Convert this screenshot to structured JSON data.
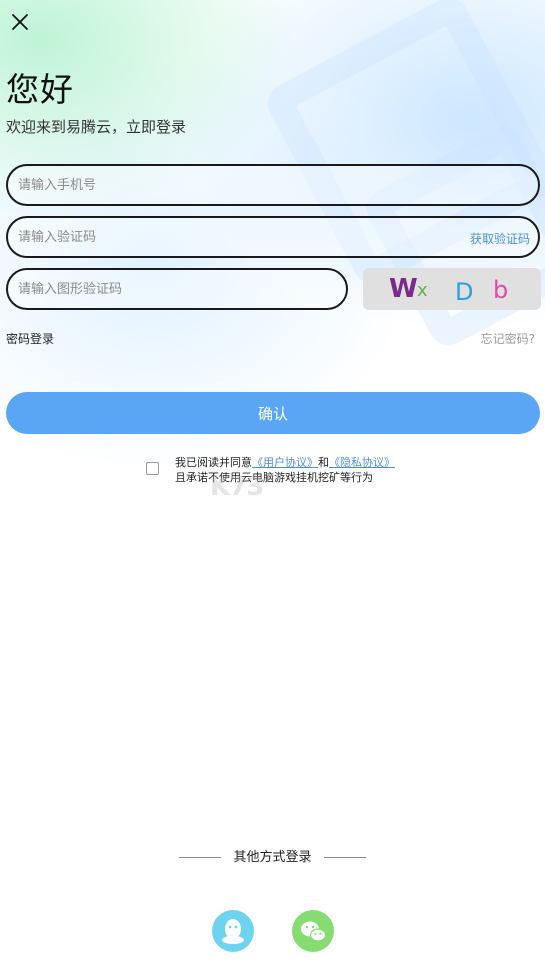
{
  "header": {
    "greeting": "您好",
    "subtitle": "欢迎来到易腾云，立即登录"
  },
  "form": {
    "phone_placeholder": "请输入手机号",
    "code_placeholder": "请输入验证码",
    "get_code_label": "获取验证码",
    "captcha_placeholder": "请输入图形验证码",
    "captcha_chars": [
      "W",
      "x",
      "D",
      "b"
    ]
  },
  "links": {
    "password_login": "密码登录",
    "forgot_password": "忘记密码?"
  },
  "confirm_label": "确认",
  "agreement": {
    "prefix": "我已阅读并同意",
    "user_agreement": "《用户协议》",
    "and": "和",
    "privacy_policy": "《隐私协议》",
    "line2": "且承诺不使用云电脑游戏挂机挖矿等行为"
  },
  "other_login": {
    "label": "其他方式登录",
    "methods": [
      "qq-icon",
      "wechat-icon"
    ]
  },
  "colors": {
    "primary": "#5ba5f5",
    "link": "#4a8fd6",
    "qq": "#6ed3ee",
    "wechat": "#86dc70"
  }
}
